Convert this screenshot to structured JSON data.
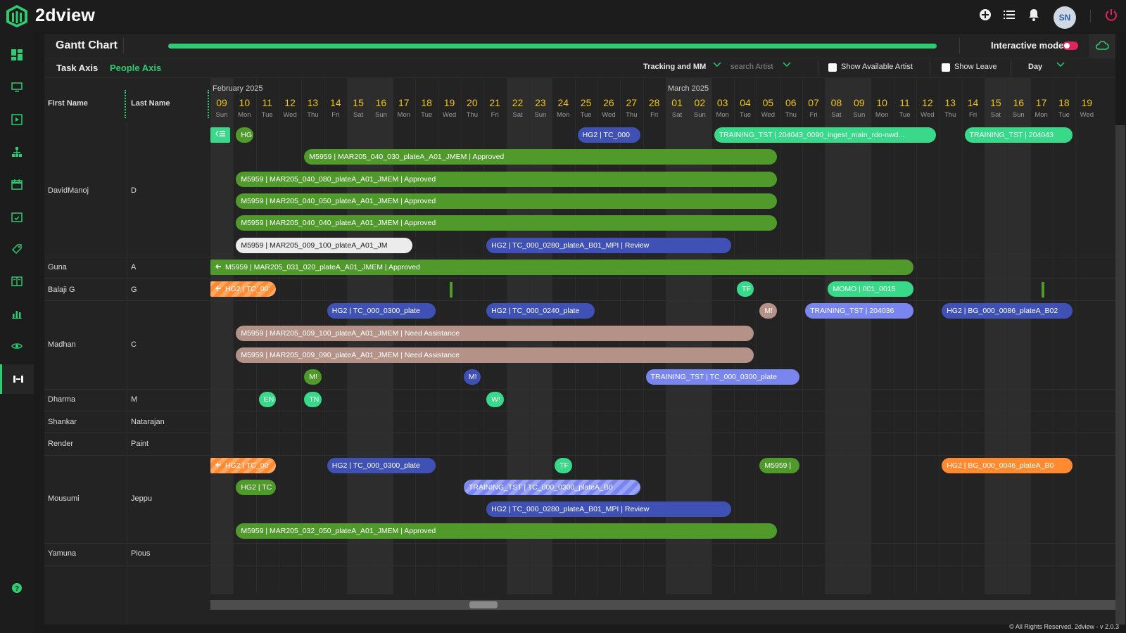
{
  "app": {
    "name": "2dview",
    "user_initials": "SN",
    "footer": "© All Rights Reserved. 2dview - v 2.0.3"
  },
  "topbar_icons": [
    "add-icon",
    "list-icon",
    "bell-icon",
    "power-icon"
  ],
  "sidebar_icons": [
    "dashboard-icon",
    "monitor-icon",
    "play-icon",
    "hierarchy-icon",
    "calendar-icon",
    "calendar-check-icon",
    "tag-icon",
    "book-icon",
    "bar-chart-icon",
    "eye-icon",
    "gantt-icon",
    "help-icon"
  ],
  "header": {
    "title": "Gantt Chart",
    "interactive_mode_label": "Interactive mode",
    "interactive_mode_on": false,
    "accent": "#2ecc71"
  },
  "toolbar": {
    "tabs": [
      {
        "label": "Task Axis",
        "active": false
      },
      {
        "label": "People Axis",
        "active": true
      }
    ],
    "filter_label": "Tracking and MM",
    "search_placeholder": "search Artist",
    "show_available_label": "Show Available Artist",
    "show_leave_label": "Show Leave",
    "scale_label": "Day"
  },
  "columns": {
    "first_name": "First Name",
    "last_name": "Last Name"
  },
  "months": [
    {
      "label": "February 2025",
      "day_index": 0
    },
    {
      "label": "March 2025",
      "day_index": 20
    }
  ],
  "days": [
    {
      "n": "09",
      "d": "Sun",
      "w": true
    },
    {
      "n": "10",
      "d": "Mon"
    },
    {
      "n": "11",
      "d": "Tue"
    },
    {
      "n": "12",
      "d": "Wed"
    },
    {
      "n": "13",
      "d": "Thu"
    },
    {
      "n": "14",
      "d": "Fri"
    },
    {
      "n": "15",
      "d": "Sat",
      "w": true
    },
    {
      "n": "16",
      "d": "Sun",
      "w": true
    },
    {
      "n": "17",
      "d": "Mon"
    },
    {
      "n": "18",
      "d": "Tue"
    },
    {
      "n": "19",
      "d": "Wed"
    },
    {
      "n": "20",
      "d": "Thu"
    },
    {
      "n": "21",
      "d": "Fri"
    },
    {
      "n": "22",
      "d": "Sat",
      "w": true
    },
    {
      "n": "23",
      "d": "Sun",
      "w": true
    },
    {
      "n": "24",
      "d": "Mon"
    },
    {
      "n": "25",
      "d": "Tue"
    },
    {
      "n": "26",
      "d": "Wed"
    },
    {
      "n": "27",
      "d": "Thu"
    },
    {
      "n": "28",
      "d": "Fri"
    },
    {
      "n": "01",
      "d": "Sat",
      "w": true
    },
    {
      "n": "02",
      "d": "Sun",
      "w": true
    },
    {
      "n": "03",
      "d": "Mon"
    },
    {
      "n": "04",
      "d": "Tue"
    },
    {
      "n": "05",
      "d": "Wed"
    },
    {
      "n": "06",
      "d": "Thu"
    },
    {
      "n": "07",
      "d": "Fri"
    },
    {
      "n": "08",
      "d": "Sat",
      "w": true
    },
    {
      "n": "09",
      "d": "Sun",
      "w": true
    },
    {
      "n": "10",
      "d": "Mon"
    },
    {
      "n": "11",
      "d": "Tue"
    },
    {
      "n": "12",
      "d": "Wed"
    },
    {
      "n": "13",
      "d": "Thu"
    },
    {
      "n": "14",
      "d": "Fri"
    },
    {
      "n": "15",
      "d": "Sat",
      "w": true
    },
    {
      "n": "16",
      "d": "Sun",
      "w": true
    },
    {
      "n": "17",
      "d": "Mon"
    },
    {
      "n": "18",
      "d": "Tue"
    },
    {
      "n": "19",
      "d": "Wed"
    }
  ],
  "artists": [
    {
      "first": "DavidManoj",
      "last": "D",
      "lanes": 6
    },
    {
      "first": "Guna",
      "last": "A",
      "lanes": 1
    },
    {
      "first": "Balaji G",
      "last": "G",
      "lanes": 1
    },
    {
      "first": "Madhan",
      "last": "C",
      "lanes": 4
    },
    {
      "first": "Dharma",
      "last": "M",
      "lanes": 1
    },
    {
      "first": "Shankar",
      "last": "Natarajan",
      "lanes": 1
    },
    {
      "first": "Render",
      "last": "Paint",
      "lanes": 1
    },
    {
      "first": "Mousumi",
      "last": "Jeppu",
      "lanes": 4
    },
    {
      "first": "Yamuna",
      "last": "Pious",
      "lanes": 1
    }
  ],
  "tasks": [
    {
      "row": 0,
      "lane": 0,
      "start": 0,
      "end": 1,
      "label": "",
      "color": "lgreen",
      "icon": "menu"
    },
    {
      "row": 0,
      "lane": 0,
      "start": 1,
      "end": 2,
      "label": "HG",
      "color": "green"
    },
    {
      "row": 0,
      "lane": 0,
      "start": 16,
      "end": 19,
      "label": "HG2 | TC_000",
      "color": "blue"
    },
    {
      "row": 0,
      "lane": 0,
      "start": 22,
      "end": 32,
      "label": "TRAINING_TST | 204043_0090_ingest_main_rdo-nwd...",
      "color": "lgreen"
    },
    {
      "row": 0,
      "lane": 0,
      "start": 33,
      "end": 38,
      "label": "TRAINING_TST | 204043",
      "color": "lgreen"
    },
    {
      "row": 0,
      "lane": 1,
      "start": 4,
      "end": 25,
      "label": "M5959 | MAR205_040_030_plateA_A01_JMEM | Approved",
      "color": "green"
    },
    {
      "row": 0,
      "lane": 2,
      "start": 1,
      "end": 25,
      "label": "M5959 | MAR205_040_080_plateA_A01_JMEM | Approved",
      "color": "green"
    },
    {
      "row": 0,
      "lane": 3,
      "start": 1,
      "end": 25,
      "label": "M5959 | MAR205_040_050_plateA_A01_JMEM | Approved",
      "color": "green"
    },
    {
      "row": 0,
      "lane": 4,
      "start": 1,
      "end": 25,
      "label": "M5959 | MAR205_040_040_plateA_A01_JMEM | Approved",
      "color": "green"
    },
    {
      "row": 0,
      "lane": 5,
      "start": 1,
      "end": 9,
      "label": "M5959 | MAR205_009_100_plateA_A01_JM",
      "color": "white"
    },
    {
      "row": 0,
      "lane": 5,
      "start": 12,
      "end": 23,
      "label": "HG2 | TC_000_0280_plateA_B01_MPI | Review",
      "color": "blue"
    },
    {
      "row": 1,
      "lane": 0,
      "start": 0,
      "end": 31,
      "label": "M5959 | MAR205_031_020_plateA_A01_JMEM | Approved",
      "color": "green",
      "icon": "arrow"
    },
    {
      "row": 2,
      "lane": 0,
      "start": 0,
      "end": 3,
      "label": "HG2 | TC_00",
      "color": "orange",
      "stripes": true,
      "icon": "arrow"
    },
    {
      "row": 2,
      "lane": 0,
      "start": 23,
      "end": 24,
      "label": "TF",
      "color": "lgreen"
    },
    {
      "row": 2,
      "lane": 0,
      "start": 27,
      "end": 31,
      "label": "MOMO | 001_0015",
      "color": "lgreen"
    },
    {
      "row": 3,
      "lane": 0,
      "start": 5,
      "end": 10,
      "label": "HG2 | TC_000_0300_plate",
      "color": "blue"
    },
    {
      "row": 3,
      "lane": 0,
      "start": 12,
      "end": 17,
      "label": "HG2 | TC_000_0240_plate",
      "color": "blue"
    },
    {
      "row": 3,
      "lane": 0,
      "start": 24,
      "end": 25,
      "label": "M!",
      "color": "pink"
    },
    {
      "row": 3,
      "lane": 0,
      "start": 26,
      "end": 31,
      "label": "TRAINING_TST | 204036",
      "color": "lblue"
    },
    {
      "row": 3,
      "lane": 0,
      "start": 32,
      "end": 38,
      "label": "HG2 | BG_000_0086_plateA_B02",
      "color": "blue"
    },
    {
      "row": 3,
      "lane": 1,
      "start": 1,
      "end": 24,
      "label": "M5959 | MAR205_009_100_plateA_A01_JMEM | Need Assistance",
      "color": "pink"
    },
    {
      "row": 3,
      "lane": 2,
      "start": 1,
      "end": 24,
      "label": "M5959 | MAR205_009_090_plateA_A01_JMEM | Need Assistance",
      "color": "pink"
    },
    {
      "row": 3,
      "lane": 3,
      "start": 4,
      "end": 5,
      "label": "M!",
      "color": "green"
    },
    {
      "row": 3,
      "lane": 3,
      "start": 11,
      "end": 12,
      "label": "M!",
      "color": "blue"
    },
    {
      "row": 3,
      "lane": 3,
      "start": 19,
      "end": 26,
      "label": "TRAINING_TST | TC_000_0300_plate",
      "color": "lblue"
    },
    {
      "row": 4,
      "lane": 0,
      "start": 2,
      "end": 3,
      "label": "EN",
      "color": "lgreen"
    },
    {
      "row": 4,
      "lane": 0,
      "start": 4,
      "end": 5,
      "label": "TN",
      "color": "lgreen"
    },
    {
      "row": 4,
      "lane": 0,
      "start": 12,
      "end": 13,
      "label": "W!",
      "color": "lgreen"
    },
    {
      "row": 7,
      "lane": 0,
      "start": 0,
      "end": 3,
      "label": "HG2 | TC_00",
      "color": "orange",
      "stripes": true,
      "icon": "arrow"
    },
    {
      "row": 7,
      "lane": 0,
      "start": 5,
      "end": 10,
      "label": "HG2 | TC_000_0300_plate",
      "color": "blue"
    },
    {
      "row": 7,
      "lane": 0,
      "start": 15,
      "end": 16,
      "label": "TF",
      "color": "lgreen"
    },
    {
      "row": 7,
      "lane": 0,
      "start": 24,
      "end": 26,
      "label": "M5959 |",
      "color": "green"
    },
    {
      "row": 7,
      "lane": 0,
      "start": 32,
      "end": 38,
      "label": "HG2 | BG_000_0046_plateA_B0",
      "color": "orange"
    },
    {
      "row": 7,
      "lane": 1,
      "start": 1,
      "end": 3,
      "label": "HG2 | TC",
      "color": "green"
    },
    {
      "row": 7,
      "lane": 1,
      "start": 11,
      "end": 19,
      "label": "TRAINING_TST | TC_000_0300_plateA_B0",
      "color": "lblue",
      "stripes": true
    },
    {
      "row": 7,
      "lane": 2,
      "start": 12,
      "end": 23,
      "label": "HG2 | TC_000_0280_plateA_B01_MPI | Review",
      "color": "blue"
    },
    {
      "row": 7,
      "lane": 3,
      "start": 1,
      "end": 25,
      "label": "M5959 | MAR205_032_050_plateA_A01_JMEM | Approved",
      "color": "green"
    }
  ]
}
